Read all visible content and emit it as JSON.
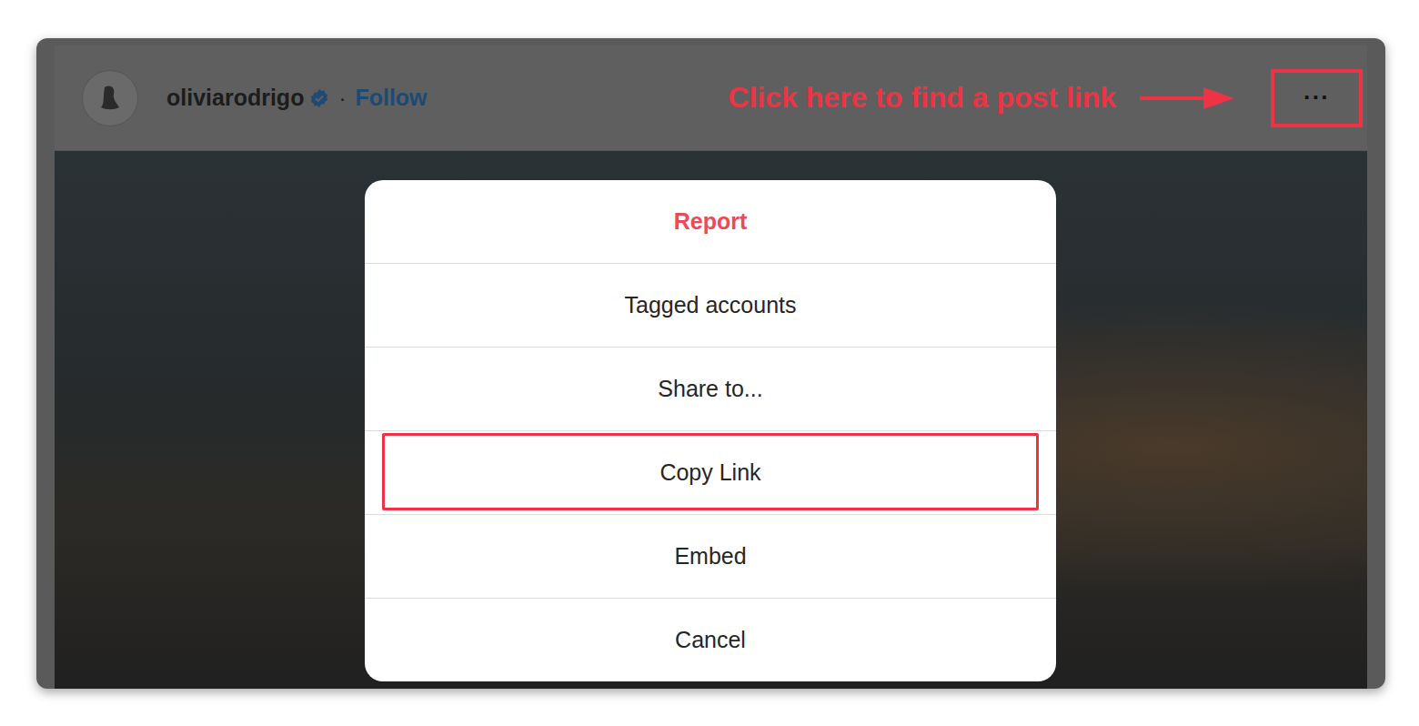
{
  "post": {
    "username": "oliviarodrigo",
    "verified": true,
    "separator": "·",
    "follow": "Follow",
    "more": "···"
  },
  "annotation": {
    "text": "Click here to find a post link"
  },
  "menu": {
    "items": [
      {
        "label": "Report",
        "kind": "danger",
        "highlighted": false
      },
      {
        "label": "Tagged accounts",
        "kind": "normal",
        "highlighted": false
      },
      {
        "label": "Share to...",
        "kind": "normal",
        "highlighted": false
      },
      {
        "label": "Copy Link",
        "kind": "normal",
        "highlighted": true
      },
      {
        "label": "Embed",
        "kind": "normal",
        "highlighted": false
      },
      {
        "label": "Cancel",
        "kind": "normal",
        "highlighted": false
      }
    ]
  }
}
